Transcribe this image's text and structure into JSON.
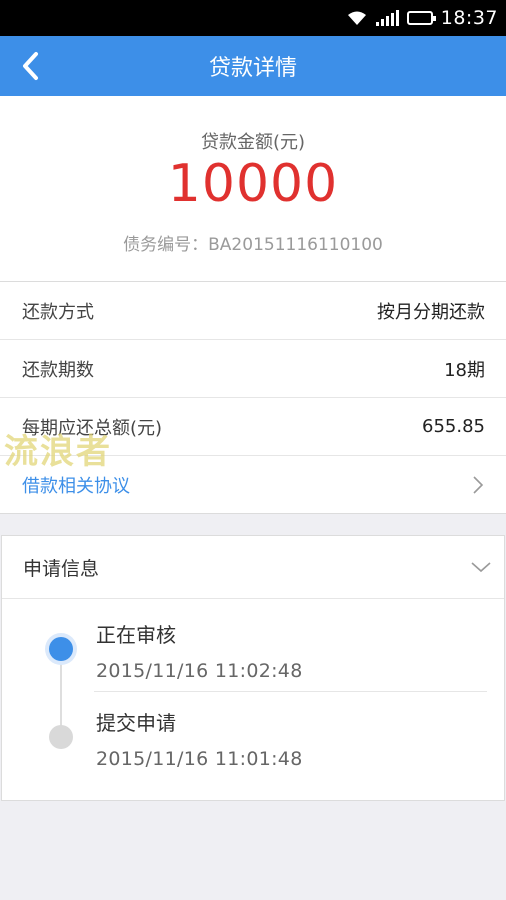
{
  "status_bar": {
    "time": "18:37"
  },
  "nav": {
    "title": "贷款详情"
  },
  "summary": {
    "amount_label": "贷款金额(元)",
    "amount": "10000",
    "debt_number": "债务编号：BA20151116110100"
  },
  "details": [
    {
      "label": "还款方式",
      "value": "按月分期还款"
    },
    {
      "label": "还款期数",
      "value": "18期"
    },
    {
      "label": "每期应还总额(元)",
      "value": "655.85"
    }
  ],
  "agreement_link": {
    "label": "借款相关协议"
  },
  "watermark": "流浪者",
  "apply_info": {
    "title": "申请信息",
    "steps": [
      {
        "name": "正在审核",
        "time": "2015/11/16 11:02:48",
        "state": "active"
      },
      {
        "name": "提交申请",
        "time": "2015/11/16 11:01:48",
        "state": "done"
      }
    ]
  },
  "colors": {
    "primary": "#3d8fe8",
    "amount": "#e0312f"
  }
}
